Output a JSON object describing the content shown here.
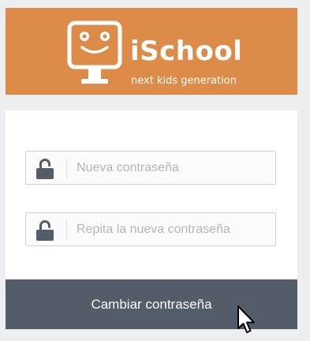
{
  "brand": {
    "name": "iSchool",
    "tagline": "next kids generation"
  },
  "form": {
    "new_password": {
      "placeholder": "Nueva contraseña",
      "value": ""
    },
    "repeat_password": {
      "placeholder": "Repita la nueva contraseña",
      "value": ""
    },
    "submit_label": "Cambiar contraseña"
  },
  "icons": {
    "logo": "ischool-logo-icon",
    "field_icon": "unlocked-padlock-icon",
    "cursor": "mouse-pointer-icon"
  },
  "colors": {
    "header_background": "#dc8c48",
    "page_background": "#eceef0",
    "button_background": "#535d69",
    "icon_color": "#535d69"
  }
}
